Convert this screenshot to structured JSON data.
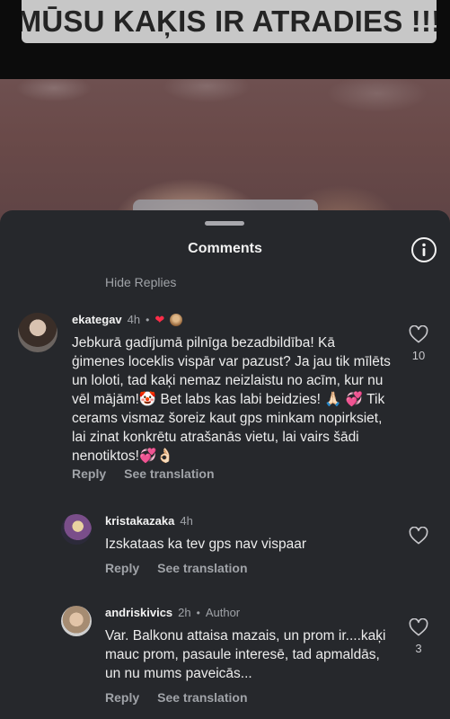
{
  "post": {
    "caption": "MŪSU KAĶIS IR ATRADIES !!!"
  },
  "sheet": {
    "title": "Comments",
    "hide_replies": "Hide Replies"
  },
  "comments": [
    {
      "username": "ekategav",
      "time": "4h",
      "text": "Jebkurā gadījumā pilnīga bezadbildība! Kā ģimenes loceklis vispār var pazust? Ja jau tik mīlēts un loloti, tad kaķi nemaz neizlaistu no acīm, kur nu vēl mājām!🤡 Bet labs kas labi beidzies! 🙏🏻 💞 Tik  cerams vismaz šoreiz kaut gps minkam nopirksiet, lai zinat konkrētu atrašanās vietu, lai vairs šādi nenotiktos!💞👌🏻",
      "reply_label": "Reply",
      "translate_label": "See translation",
      "likes": "10"
    },
    {
      "username": "kristakazaka",
      "time": "4h",
      "text": "Izskataas ka tev gps nav vispaar",
      "reply_label": "Reply",
      "translate_label": "See translation",
      "likes": ""
    },
    {
      "username": "andriskivics",
      "time": "2h",
      "author_badge": "Author",
      "text": "Var. Balkonu attaisa mazais, un prom ir....kaķi mauc prom, pasaule interesē, tad apmaldās, un nu mums paveicās...",
      "reply_label": "Reply",
      "translate_label": "See translation",
      "likes": "3"
    }
  ],
  "colors": {
    "sheet_bg": "#26282c",
    "secondary_text": "#a0a3a8",
    "heart_red": "#ff2d48"
  },
  "icons": [
    "info-icon",
    "heart-outline-icon",
    "heart-filled-icon"
  ]
}
